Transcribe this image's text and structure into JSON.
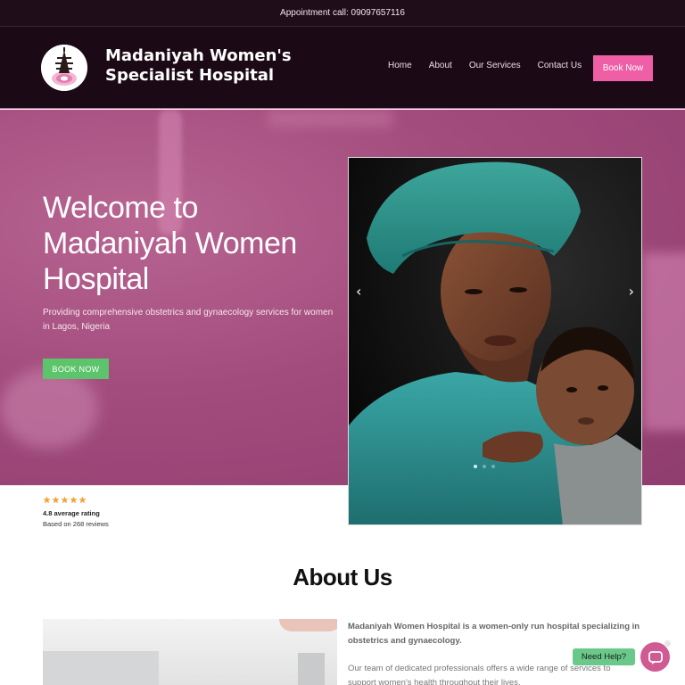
{
  "topbar": {
    "text": "Appointment call: 09097657116"
  },
  "header": {
    "site_title": "Madaniyah Women's Specialist Hospital",
    "nav": [
      "Home",
      "About",
      "Our Services",
      "Contact Us"
    ],
    "book_label": "Book Now"
  },
  "hero": {
    "title": "Welcome to Madaniyah Women Hospital",
    "subtitle": "Providing comprehensive obstetrics and gynaecology services for women in Lagos, Nigeria",
    "button_label": "BOOK NOW"
  },
  "carousel": {
    "prev_icon": "chevron-left-icon",
    "next_icon": "chevron-right-icon",
    "slides": 3,
    "active": 1
  },
  "rating": {
    "stars": 5,
    "average": "4.8 average rating",
    "count": "Based on 268 reviews"
  },
  "about": {
    "title": "About Us",
    "lead": "Madaniyah Women Hospital is a women-only run hospital specializing in obstetrics and gynaecology.",
    "body": "Our team of dedicated professionals offers a wide range of services to support women's health throughout their lives."
  },
  "chat": {
    "label": "Need Help?",
    "icon": "chat-icon"
  },
  "colors": {
    "header_bg": "#1b0a16",
    "accent": "#ee5fa6",
    "hero": "#a24c7d",
    "cta_green": "#5cc46a"
  }
}
